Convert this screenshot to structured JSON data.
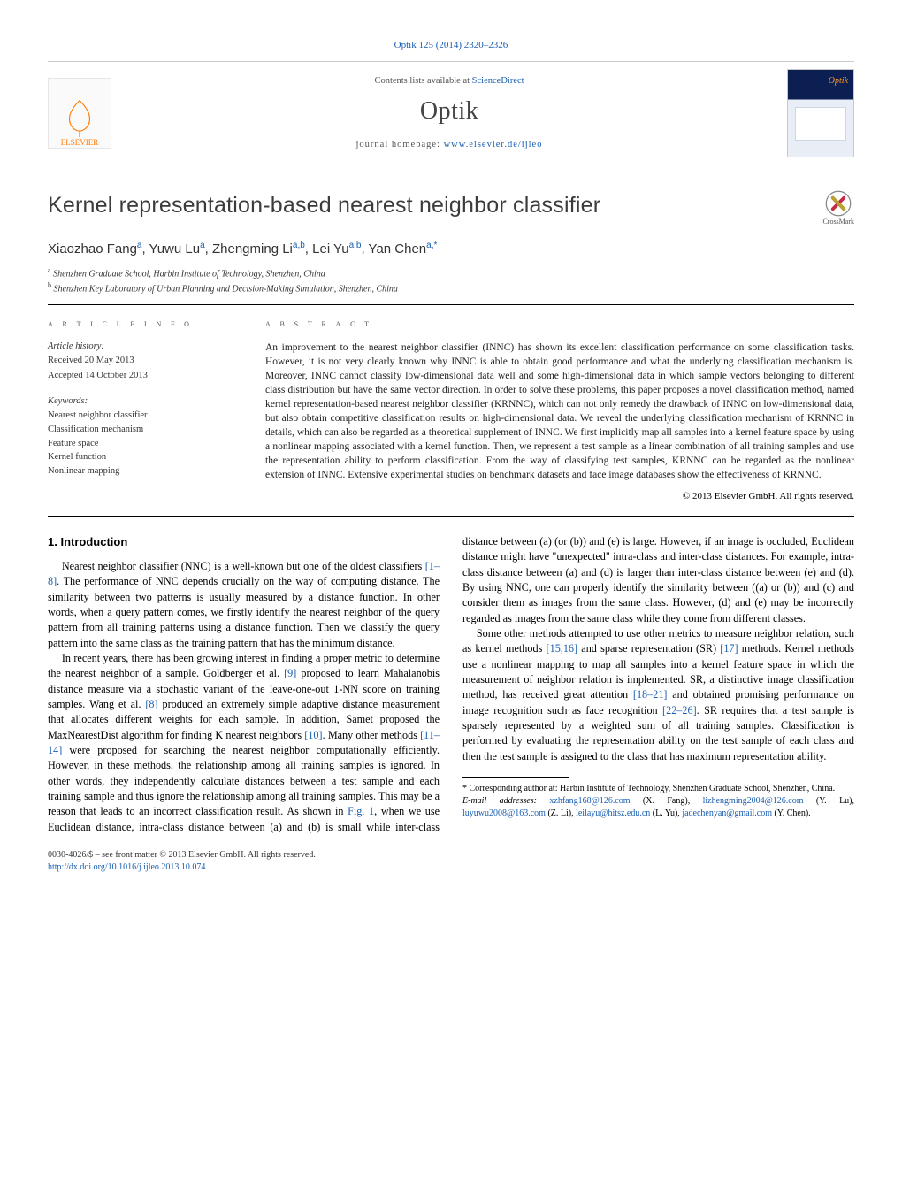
{
  "top_citation": "Optik 125 (2014) 2320–2326",
  "header": {
    "contents_prefix": "Contents lists available at ",
    "contents_link": "ScienceDirect",
    "journal": "Optik",
    "homepage_prefix": "journal homepage: ",
    "homepage_link": "www.elsevier.de/ijleo",
    "elsevier": "ELSEVIER",
    "cover_title": "Optik"
  },
  "crossmark": "CrossMark",
  "title": "Kernel representation-based nearest neighbor classifier",
  "authors_html": "Xiaozhao Fang<sup>a</sup>, Yuwu Lu<sup>a</sup>, Zhengming Li<sup>a,b</sup>, Lei Yu<sup>a,b</sup>, Yan Chen<sup>a,*</sup>",
  "affiliations": [
    {
      "sup": "a",
      "text": "Shenzhen Graduate School, Harbin Institute of Technology, Shenzhen, China"
    },
    {
      "sup": "b",
      "text": "Shenzhen Key Laboratory of Urban Planning and Decision-Making Simulation, Shenzhen, China"
    }
  ],
  "info": {
    "heading": "a r t i c l e   i n f o",
    "history_label": "Article history:",
    "received": "Received 20 May 2013",
    "accepted": "Accepted 14 October 2013",
    "keywords_label": "Keywords:",
    "keywords": [
      "Nearest neighbor classifier",
      "Classification mechanism",
      "Feature space",
      "Kernel function",
      "Nonlinear mapping"
    ]
  },
  "abstract": {
    "heading": "a b s t r a c t",
    "text": "An improvement to the nearest neighbor classifier (INNC) has shown its excellent classification performance on some classification tasks. However, it is not very clearly known why INNC is able to obtain good performance and what the underlying classification mechanism is. Moreover, INNC cannot classify low-dimensional data well and some high-dimensional data in which sample vectors belonging to different class distribution but have the same vector direction. In order to solve these problems, this paper proposes a novel classification method, named kernel representation-based nearest neighbor classifier (KRNNC), which can not only remedy the drawback of INNC on low-dimensional data, but also obtain competitive classification results on high-dimensional data. We reveal the underlying classification mechanism of KRNNC in details, which can also be regarded as a theoretical supplement of INNC. We first implicitly map all samples into a kernel feature space by using a nonlinear mapping associated with a kernel function. Then, we represent a test sample as a linear combination of all training samples and use the representation ability to perform classification. From the way of classifying test samples, KRNNC can be regarded as the nonlinear extension of INNC. Extensive experimental studies on benchmark datasets and face image databases show the effectiveness of KRNNC.",
    "copyright": "© 2013 Elsevier GmbH. All rights reserved."
  },
  "body": {
    "h1": "1.  Introduction",
    "p1_a": "Nearest neighbor classifier (NNC) is a well-known but one of the oldest classifiers ",
    "p1_cite": "[1–8]",
    "p1_b": ". The performance of NNC depends crucially on the way of computing distance. The similarity between two patterns is usually measured by a distance function. In other words, when a query pattern comes, we firstly identify the nearest neighbor of the query pattern from all training patterns using a distance function. Then we classify the query pattern into the same class as the training pattern that has the minimum distance.",
    "p2_a": "In recent years, there has been growing interest in finding a proper metric to determine the nearest neighbor of a sample. Goldberger et al. ",
    "p2_c1": "[9]",
    "p2_b": " proposed to learn Mahalanobis distance measure via a stochastic variant of the leave-one-out 1-NN score on training samples. Wang et al. ",
    "p2_c2": "[8]",
    "p2_c": " produced an extremely simple adaptive distance measurement that allocates different weights for each sample. In addition, Samet proposed the MaxNearestDist algorithm for finding K nearest neighbors ",
    "p2_c3": "[10]",
    "p2_d": ". Many other methods ",
    "p2_c4": "[11–14]",
    "p2_e": " were proposed for searching the nearest neighbor computationally efficiently. However, in these methods, the relationship among all training samples is ignored. In other words, they independently calculate distances between a test sample and each training sample and thus ignore the relationship among all training samples. This may be a reason that leads to an incorrect classification result. As shown in ",
    "p2_fig": "Fig. 1",
    "p2_f": ", when we use Euclidean distance, intra-class distance between (a) and (b) is small while inter-class distance between (a) (or (b)) and (e) is large. However, if an image is occluded, Euclidean distance might have \"unexpected\" intra-class and inter-class distances. For example, intra-class distance between (a) and (d) is larger than inter-class distance between (e) and (d). By using NNC, one can properly identify the similarity between ((a) or (b)) and (c) and consider them as images from the same class. However, (d) and (e) may be incorrectly regarded as images from the same class while they come from different classes.",
    "p3_a": "Some other methods attempted to use other metrics to measure neighbor relation, such as kernel methods ",
    "p3_c1": "[15,16]",
    "p3_b": " and sparse representation (SR) ",
    "p3_c2": "[17]",
    "p3_c": " methods. Kernel methods use a nonlinear mapping to map all samples into a kernel feature space in which the measurement of neighbor relation is implemented. SR, a distinctive image classification method, has received great attention ",
    "p3_c3": "[18–21]",
    "p3_d": " and obtained promising performance on image recognition such as face recognition ",
    "p3_c4": "[22–26]",
    "p3_e": ". SR requires that a test sample is sparsely represented by a weighted sum of all training samples. Classification is performed by evaluating the representation ability on the test sample of each class and then the test sample is assigned to the class that has maximum representation ability."
  },
  "footnote": {
    "corr": "* Corresponding author at: Harbin Institute of Technology, Shenzhen Graduate School, Shenzhen, China.",
    "emails_label": "E-mail addresses: ",
    "emails": [
      {
        "addr": "xzhfang168@126.com",
        "who": "(X. Fang)"
      },
      {
        "addr": "lizhengming2004@126.com",
        "who": "(Y. Lu)"
      },
      {
        "addr": "luyuwu2008@163.com",
        "who": "(Z. Li)"
      },
      {
        "addr": "leilayu@hitsz.edu.cn",
        "who": "(L. Yu)"
      },
      {
        "addr": "jadechenyan@gmail.com",
        "who": "(Y. Chen)."
      }
    ]
  },
  "bottom": {
    "line1": "0030-4026/$ – see front matter © 2013 Elsevier GmbH. All rights reserved.",
    "doi": "http://dx.doi.org/10.1016/j.ijleo.2013.10.074"
  }
}
